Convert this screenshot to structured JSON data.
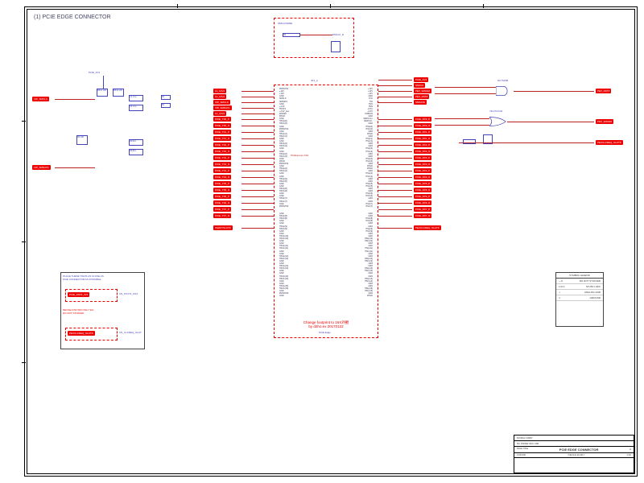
{
  "title": "(1) PCIE EDGE CONNECTOR",
  "chip": {
    "refdes": "JP1_A",
    "part": "PCIExpress X16",
    "footprint_note_l1": "Change footprint to 16X外觀",
    "footprint_note_l2": "by d2ho.ex 20170122",
    "section_label": "PCIE Edge"
  },
  "top_block": {
    "label": "SMCLKWIRE",
    "refdes": "R4",
    "net": "SMCLK_R"
  },
  "left_tags": [
    "12_12V2",
    "12_12V2",
    "XW_SMCLK",
    "XW_SMDATA",
    "12_12V2",
    "PCIE_TX0_P",
    "PCIE_TX0_N",
    "PCIE_TX1_P",
    "PCIE_TX1_N",
    "PCIE_TX2_P",
    "PCIE_TX2_N",
    "PCIE_TX3_P",
    "PCIE_TX3_N",
    "PCIE_TX4_P",
    "PCIE_TX4_N",
    "PCIE_TX5_P",
    "PCIE_TX5_N",
    "PCIE_TX6_P",
    "PCIE_TX6_N",
    "PCIE_TX7_P",
    "PCIE_TX7_N",
    "PERSTSLOT#"
  ],
  "right_tags": [
    "PCIE_3V3",
    "SMCLK",
    "PEX_WAKE#",
    "PEX_RST#",
    "SMDATA",
    "PCIE_RX0_P",
    "PCIE_RX0_N",
    "PCIE_RX1_P",
    "PCIE_RX1_N",
    "PCIE_RX2_P",
    "PCIE_RX2_N",
    "PCIE_RX3_P",
    "PCIE_RX3_N",
    "PCIE_RX4_P",
    "PCIE_RX4_N",
    "PCIE_RX5_P",
    "PCIE_RX5_N",
    "PCIE_RX6_P",
    "PCIE_RX6_N",
    "PCIE_RX7_P",
    "PCIE_RX7_N",
    "PEXCLKREQ_SLOT#"
  ],
  "far_left_tags": [
    "XW_SMCLK",
    "XW_SMDATA"
  ],
  "far_right_tags": [
    "PEX_RST#",
    "PEX_WAKE#",
    "PEXCLKREQ_SLOT#"
  ],
  "pins_left": [
    "PRSNT#1",
    "+12V",
    "+12V",
    "GND",
    "SMCLK",
    "SMDATA",
    "GND",
    "+3.3V",
    "TRST#",
    "+3.3V_Aux",
    "WAKE#",
    "RSVD",
    "GND",
    "HSOp(0)",
    "HSOn(0)",
    "GND",
    "PRSNT#2",
    "GND",
    "HSOp(1)",
    "HSOn(1)",
    "GND",
    "GND",
    "HSOp(2)",
    "HSOn(2)",
    "GND",
    "GND",
    "HSOp(3)",
    "HSOn(3)",
    "GND",
    "RSVD",
    "PRSNT#2",
    "GND",
    "HSOp(4)",
    "HSOn(4)",
    "GND",
    "GND",
    "HSOp(5)",
    "HSOn(5)",
    "GND",
    "GND",
    "HSOp(6)",
    "HSOn(6)",
    "GND",
    "GND",
    "HSOp(7)",
    "HSOn(7)",
    "GND",
    "PRSNT#2"
  ],
  "pins_right": [
    "+12V",
    "+12V",
    "+12V",
    "GND",
    "TCK",
    "TDI",
    "TDO",
    "TMS",
    "+3.3V",
    "+3.3V",
    "PWRGD",
    "GND",
    "REFCLK+",
    "REFCLK-",
    "GND",
    "HSIp(0)",
    "HSIn(0)",
    "GND",
    "RSVD",
    "GND",
    "HSIp(1)",
    "HSIn(1)",
    "GND",
    "GND",
    "HSIp(2)",
    "HSIn(2)",
    "GND",
    "GND",
    "HSIp(3)",
    "HSIn(3)",
    "GND",
    "RSVD",
    "RSVD",
    "GND",
    "HSIp(4)",
    "HSIn(4)",
    "GND",
    "GND",
    "HSIp(5)",
    "HSIn(5)",
    "GND",
    "GND",
    "HSIp(6)",
    "HSIn(6)",
    "GND",
    "GND",
    "HSIp(7)",
    "HSIn(7)"
  ],
  "lower_pins_left": [
    "GND",
    "HSOp(8)",
    "HSOn(8)",
    "GND",
    "GND",
    "HSOp(9)",
    "HSOn(9)",
    "GND",
    "GND",
    "HSOp(10)",
    "HSOn(10)",
    "GND",
    "GND",
    "HSOp(11)",
    "HSOn(11)",
    "GND",
    "GND",
    "HSOp(12)",
    "HSOn(12)",
    "GND",
    "GND",
    "HSOp(13)",
    "HSOn(13)",
    "GND",
    "GND",
    "HSOp(14)",
    "HSOn(14)",
    "GND",
    "GND",
    "HSOp(15)",
    "HSOn(15)",
    "GND",
    "PRSNT#2",
    "GND"
  ],
  "lower_pins_right": [
    "GND",
    "GND",
    "HSIp(8)",
    "HSIn(8)",
    "GND",
    "GND",
    "HSIp(9)",
    "HSIn(9)",
    "GND",
    "GND",
    "HSIp(10)",
    "HSIn(10)",
    "GND",
    "GND",
    "HSIp(11)",
    "HSIn(11)",
    "GND",
    "GND",
    "HSIp(12)",
    "HSIn(12)",
    "GND",
    "GND",
    "HSIp(13)",
    "HSIn(13)",
    "GND",
    "GND",
    "HSIp(14)",
    "HSIn(14)",
    "GND",
    "GND",
    "HSIp(15)",
    "HSIn(15)",
    "GND",
    "RSVD"
  ],
  "components": {
    "R541": "R541  10K",
    "R542": "R542  10K",
    "C1": "C1  0.1u",
    "C2": "C2  0.1u",
    "R1": "R1",
    "R2": "R2",
    "R6": "R6  10K",
    "R649": "R649  0",
    "R648": "R648  0",
    "U1": "NC7SZ08",
    "U2": "74LVC1G32"
  },
  "subnote": {
    "l1": "PLACE THESE TWOS AS CLOSE AS",
    "l2": "PCIE CONNECTOR AS POSSIBLE",
    "l3": "REUSE FOR SIM ONLY SIG",
    "l4": "DO NOT STUFFED",
    "tag1": "PCIE_RST#_3V3",
    "tag2": "PEXCLKREQ_SLOT#",
    "cn1": "CN_PCVT1_RST",
    "cn2": "CN_CLKREQ_SLOT"
  },
  "legend": {
    "title": "SYMBOL LEGEND",
    "rows": [
      {
        "sym": "—X",
        "desc": "DO NOT STUFFED"
      },
      {
        "sym": "L,R,C",
        "desc": "STUFF L/R/C"
      },
      {
        "sym": "⊥",
        "desc": "ANALOG GND"
      },
      {
        "sym": "▽",
        "desc": "GROUND"
      }
    ]
  },
  "titleblock": {
    "company": "NVIDIA CORP.",
    "project": "NV PG500 SKU 200",
    "page_title": "PCIE EDGE CONNECTOR",
    "size": "CUSTOM",
    "rev": "A",
    "date": "TUE AUG 29 2017",
    "sheet": "1 OF"
  }
}
